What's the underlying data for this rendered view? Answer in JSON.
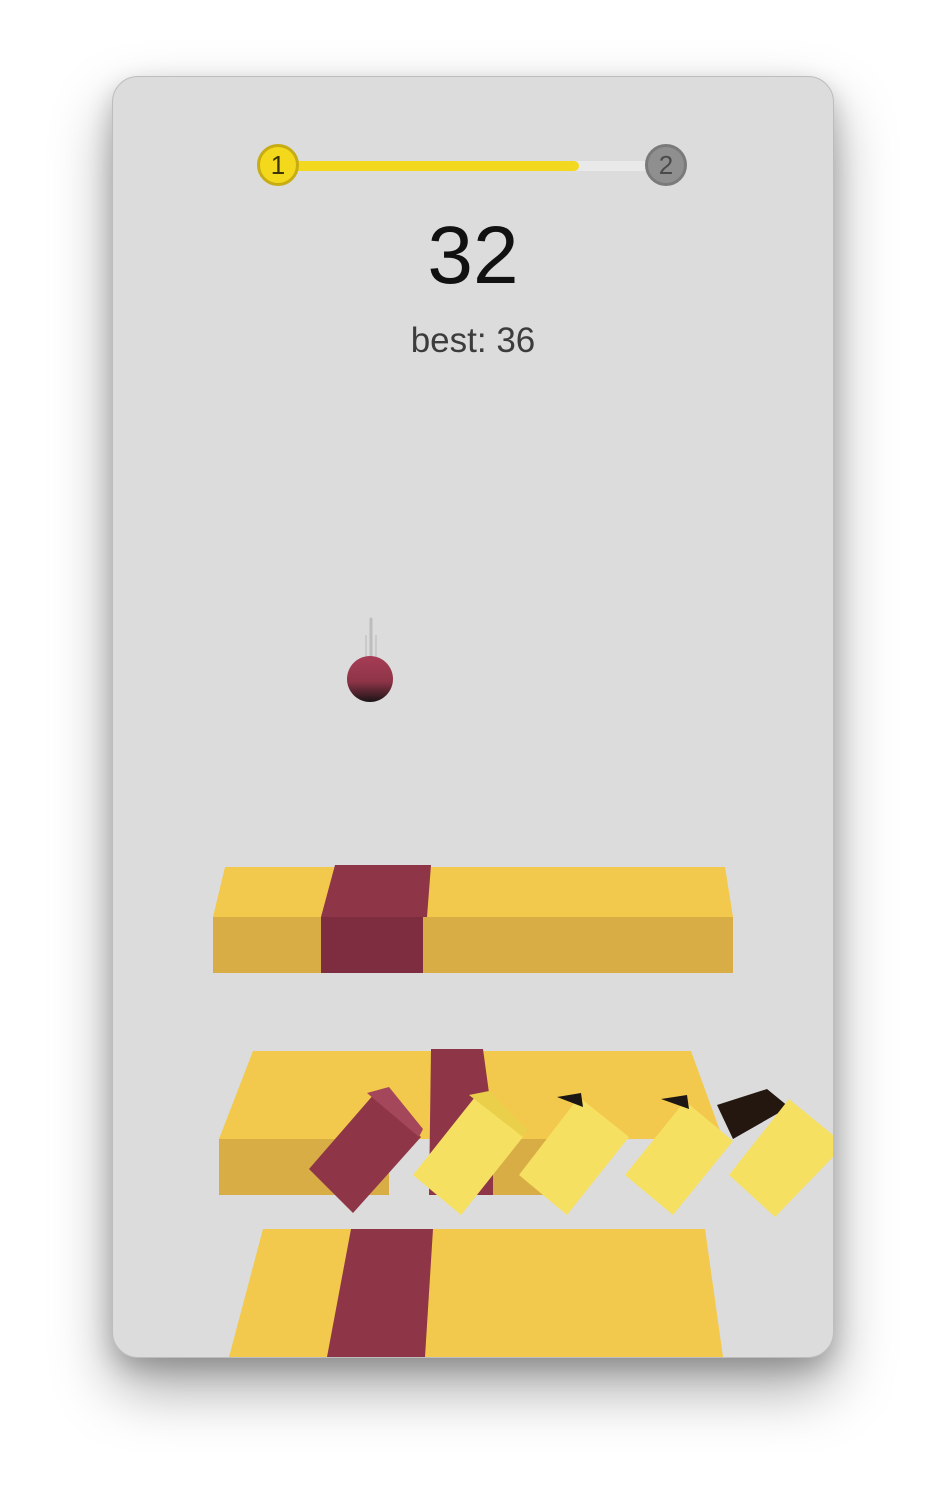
{
  "hud": {
    "current_level": "1",
    "next_level": "2",
    "level_progress": 0.78,
    "score": "32",
    "best_label": "best: 36"
  },
  "colors": {
    "background": "#dcdcdd",
    "platform_yellow": "#f2c94c",
    "platform_dark_yellow": "#d8ad45",
    "danger_red": "#8f3548",
    "ball": "#8f3548",
    "progress_fill": "#f2d91f"
  }
}
